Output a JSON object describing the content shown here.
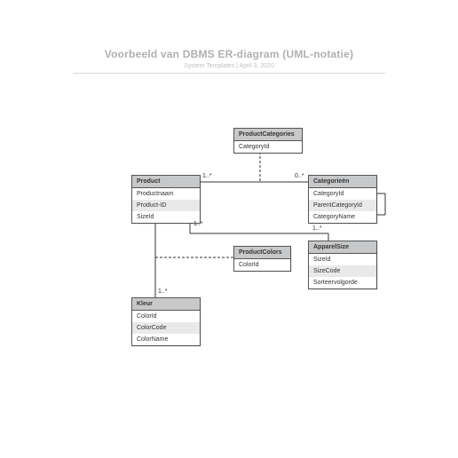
{
  "header": {
    "title": "Voorbeeld van DBMS ER-diagram (UML-notatie)",
    "subtitle_author": "System Templates",
    "subtitle_sep": "  |  ",
    "subtitle_date": "April 3, 2020"
  },
  "entities": {
    "product_categories": {
      "name": "ProductCategories",
      "rows": [
        "CategoryId"
      ]
    },
    "product": {
      "name": "Product",
      "rows": [
        "Productnaam",
        "Product-ID",
        "SizeId"
      ]
    },
    "categorieen": {
      "name": "Categorieën",
      "rows": [
        "CategoryId",
        "ParentCategoryId",
        "CategoryName"
      ]
    },
    "product_colors": {
      "name": "ProductColors",
      "rows": [
        "ColorId"
      ]
    },
    "apparel_size": {
      "name": "ApparelSize",
      "rows": [
        "SizeId",
        "SizeCode",
        "Sorteervolgorde"
      ]
    },
    "kleur": {
      "name": "Kleur",
      "rows": [
        "ColorId",
        "ColorCode",
        "ColorName"
      ]
    }
  },
  "multiplicities": {
    "prod_cat_left": "1..*",
    "prod_cat_right": "0..*",
    "prod_size_bottom": "1..*",
    "size_top": "1..*",
    "color_top": "1..*"
  }
}
